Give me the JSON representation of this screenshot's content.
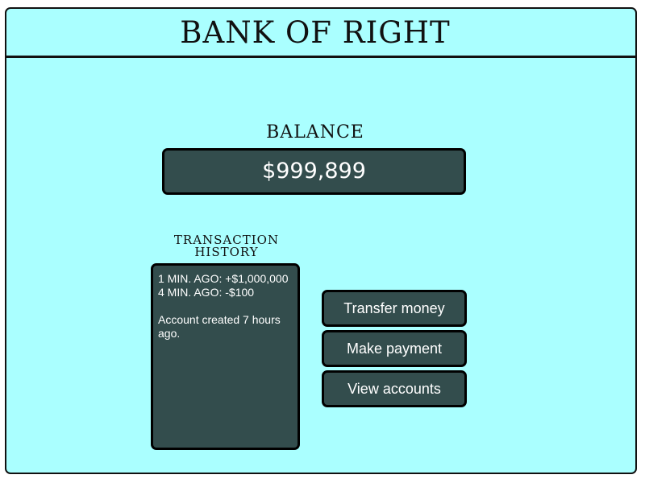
{
  "header": {
    "bank_name": "BANK OF RIGHT"
  },
  "balance": {
    "label": "BALANCE",
    "value": "$999,899"
  },
  "history": {
    "title": "TRANSACTION HISTORY",
    "entries": [
      "1 MIN. AGO: +$1,000,000",
      "4 MIN. AGO: -$100"
    ],
    "note": "Account created 7 hours ago."
  },
  "actions": {
    "transfer_label": "Transfer money",
    "payment_label": "Make payment",
    "accounts_label": "View accounts"
  },
  "colors": {
    "background": "#aaffff",
    "panel": "#334d4d",
    "border": "#000000",
    "panel_text": "#ffffff"
  }
}
